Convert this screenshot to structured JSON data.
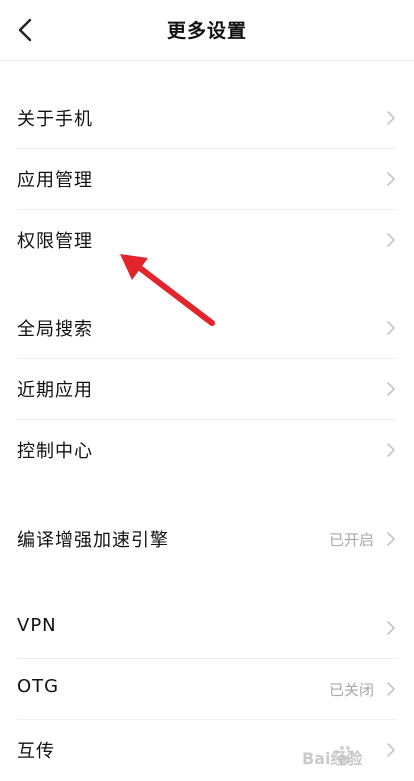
{
  "header": {
    "title": "更多设置",
    "back_icon": "chevron-left-icon"
  },
  "rows": [
    {
      "label": "关于手机",
      "value": ""
    },
    {
      "label": "应用管理",
      "value": ""
    },
    {
      "label": "权限管理",
      "value": ""
    },
    {
      "label": "全局搜索",
      "value": ""
    },
    {
      "label": "近期应用",
      "value": ""
    },
    {
      "label": "控制中心",
      "value": ""
    },
    {
      "label": "编译增强加速引擎",
      "value": "已开启"
    },
    {
      "label": "VPN",
      "value": ""
    },
    {
      "label": "OTG",
      "value": "已关闭"
    },
    {
      "label": "互传",
      "value": ""
    }
  ],
  "colors": {
    "annotation_arrow": "#e3242b",
    "secondary_text": "#a8a8a8",
    "chevron": "#c4c4c4"
  },
  "watermark": {
    "text": "Bai经验",
    "logo": "baidu-paw-logo"
  }
}
